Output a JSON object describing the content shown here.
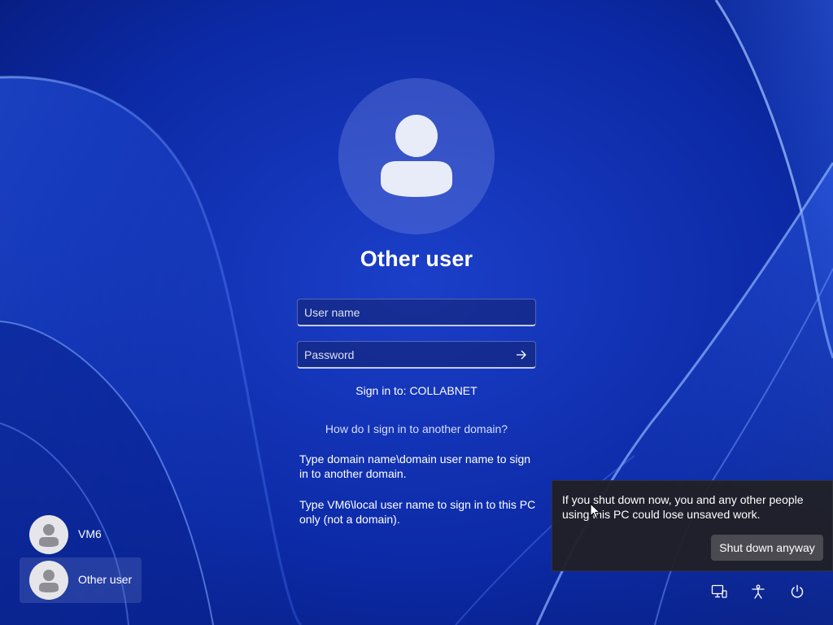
{
  "lock_screen": {
    "selected_user": "Other user",
    "username_placeholder": "User name",
    "password_placeholder": "Password",
    "sign_in_to": "Sign in to: COLLABNET",
    "other_domain_link": "How do I sign in to another domain?",
    "help_domain": "Type domain name\\domain user name to sign in to another domain.",
    "help_local": "Type VM6\\local user name to sign in to this PC only (not a domain)."
  },
  "users": [
    {
      "name": "VM6",
      "selected": false
    },
    {
      "name": "Other user",
      "selected": true
    }
  ],
  "shutdown_warning": {
    "message": "If you shut down now, you and any other people using this PC could lose unsaved work.",
    "button_label": "Shut down anyway"
  },
  "system_icons": [
    "network-icon",
    "accessibility-icon",
    "power-icon"
  ],
  "colors": {
    "background": "#0b2a9c",
    "popup": "#202026",
    "popup_button": "#4a4a50",
    "text": "#ffffff"
  }
}
